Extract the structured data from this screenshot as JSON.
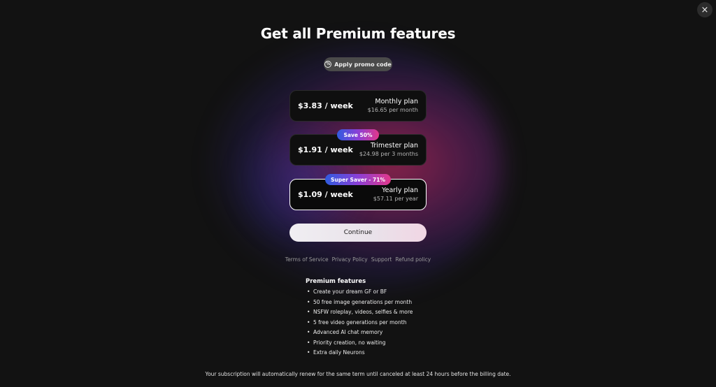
{
  "close_icon": "×",
  "title": "Get all Premium features",
  "promo": {
    "icon": "%",
    "label": "Apply promo code"
  },
  "plans": [
    {
      "price": "$3.83 / week",
      "name": "Monthly plan",
      "sub": "$16.65 per month",
      "badge": ""
    },
    {
      "price": "$1.91 / week",
      "name": "Trimester plan",
      "sub": "$24.98 per 3 months",
      "badge": "Save 50%"
    },
    {
      "price": "$1.09 / week",
      "name": "Yearly plan",
      "sub": "$57.11 per year",
      "badge": "Super Saver - 71%"
    }
  ],
  "continue_label": "Continue",
  "links": [
    "Terms of Service",
    "Privacy Policy",
    "Support",
    "Refund policy"
  ],
  "features": {
    "title": "Premium features",
    "items": [
      "Create your dream GF or BF",
      "50 free image generations per month",
      "NSFW roleplay, videos, selfies & more",
      "5 free video generations per month",
      "Advanced AI chat memory",
      "Priority creation, no waiting",
      "Extra daily Neurons"
    ]
  },
  "disclaimer": "Your subscription will automatically renew for the same term until canceled at least 24 hours before the billing date."
}
